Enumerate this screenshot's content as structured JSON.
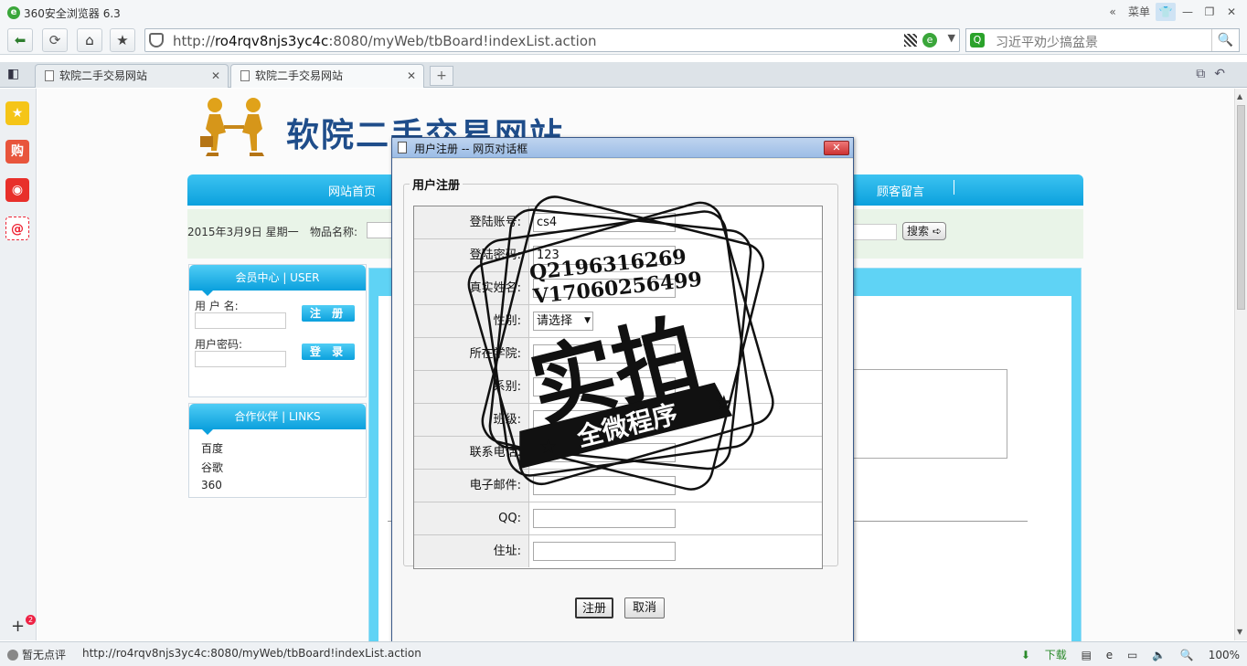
{
  "browser": {
    "app_title": "360安全浏览器 6.3",
    "menu_label": "菜单",
    "address": {
      "url_prefix": "http://",
      "host": "ro4rqv8njs3yc4c",
      "url_rest": ":8080/myWeb/tbBoard!indexList.action"
    },
    "search_query": "习近平劝少搞盆景",
    "tabs": [
      {
        "label": "软院二手交易网站"
      },
      {
        "label": "软院二手交易网站"
      }
    ],
    "status": {
      "rating": "暂无点评",
      "hover_url": "http://ro4rqv8njs3yc4c:8080/myWeb/tbBoard!indexList.action",
      "download": "下载",
      "zoom": "100%"
    },
    "dock_badge": "2"
  },
  "site": {
    "title": "软院二手交易网站",
    "nav": [
      "网站首页",
      "顾客留言"
    ],
    "date": "2015年3月9日 星期一",
    "product_name_label": "物品名称:",
    "search_button": "搜索",
    "member_panel": {
      "header": "会员中心 | USER",
      "username_label": "用 户 名:",
      "password_label": "用户密码:",
      "register_button": "注 册",
      "login_button": "登 录"
    },
    "links_panel": {
      "header": "合作伙伴 | LINKS",
      "links": [
        "百度",
        "谷歌",
        "360"
      ]
    }
  },
  "dialog": {
    "title": "用户注册 -- 网页对话框",
    "group_title": "用户注册",
    "fields": [
      {
        "label": "登陆账号:",
        "value": "cs4",
        "type": "text"
      },
      {
        "label": "登陆密码:",
        "value": "123",
        "type": "text"
      },
      {
        "label": "真实姓名:",
        "value": "",
        "type": "text"
      },
      {
        "label": "性别:",
        "value": "请选择",
        "type": "select"
      },
      {
        "label": "所在学院:",
        "value": "",
        "type": "text"
      },
      {
        "label": "系别:",
        "value": "",
        "type": "text"
      },
      {
        "label": "班级:",
        "value": "",
        "type": "text"
      },
      {
        "label": "联系电话:",
        "value": "",
        "type": "text"
      },
      {
        "label": "电子邮件:",
        "value": "",
        "type": "text"
      },
      {
        "label": "QQ:",
        "value": "",
        "type": "text"
      },
      {
        "label": "住址:",
        "value": "",
        "type": "text"
      }
    ],
    "submit_button": "注册",
    "cancel_button": "取消"
  },
  "watermark": {
    "line1": "Q2196316269",
    "line2": "V17060256499",
    "main": "实拍",
    "banner": "全微程序"
  },
  "colors": {
    "nav_blue": "#0ba0dd",
    "site_title": "#1f4d8a",
    "green_accent": "#3aa63a"
  }
}
